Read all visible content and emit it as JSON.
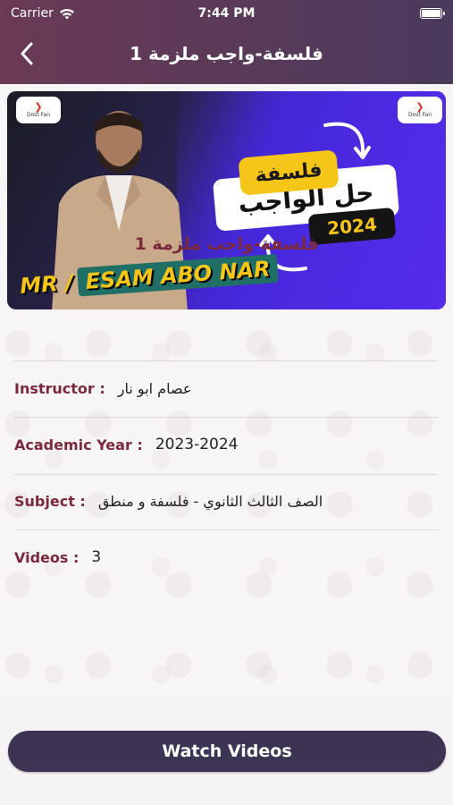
{
  "status_bar": {
    "carrier": "Carrier",
    "time": "7:44 PM"
  },
  "nav": {
    "title": "فلسفة-واجب ملزمة 1",
    "back_icon": "chevron-left-icon"
  },
  "banner": {
    "logo_label": "Dost Fan",
    "subject_tag": "فلسفة",
    "main_tag": "حل الواجب",
    "year_tag": "2024",
    "name_prefix": "MR /",
    "name_main": "ESAM ABO NAR"
  },
  "course": {
    "title": "فلسفة-واجب ملزمة 1"
  },
  "details": {
    "instructor_label": "Instructor :",
    "instructor_value": "عصام ابو نار",
    "year_label": "Academic Year :",
    "year_value": "2023-2024",
    "subject_label": "Subject :",
    "subject_value": "الصف الثالث الثانوي - فلسفة و منطق",
    "videos_label": "Videos :",
    "videos_value": "3"
  },
  "actions": {
    "watch_label": "Watch Videos"
  },
  "colors": {
    "header_start": "#6b3a55",
    "header_end": "#4a3a5c",
    "label_color": "#7a2a3c",
    "button_bg": "#3d3454"
  }
}
